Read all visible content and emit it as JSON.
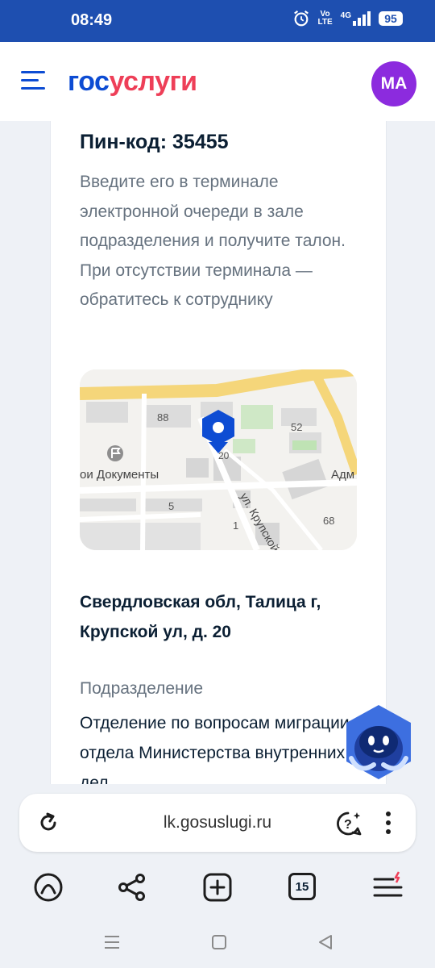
{
  "status_bar": {
    "time": "08:49",
    "volte_line1": "Vo",
    "volte_line2": "LTE",
    "network": "4G",
    "battery": "95",
    "icons": [
      "alarm-icon",
      "volte-icon",
      "signal-icon",
      "battery-icon"
    ]
  },
  "header": {
    "logo_part1": "гос",
    "logo_part2": "услуги",
    "avatar_initials": "МА",
    "colors": {
      "brand_blue": "#0d4cd3",
      "brand_red": "#ee3f58",
      "avatar": "#8c2bde"
    }
  },
  "card": {
    "pin_label": "Пин-код: 35455",
    "description": "Введите его в терминале электронной очереди в зале подразделения и получите талон. При отсутствии терминала — обратитесь к сотруднику",
    "map": {
      "label_88": "88",
      "label_52": "52",
      "label_20": "20",
      "label_5": "5",
      "label_1": "1",
      "label_68": "68",
      "poi": "ои Документы",
      "street": "ул. Крупской",
      "adm": "Адм"
    },
    "address": "Свердловская обл, Талица г, Крупской ул, д. 20",
    "department_label": "Подразделение",
    "department_value": "Отделение по вопросам миграции отдела Министерства внутренних дел"
  },
  "browser": {
    "url": "lk.gosuslugi.ru",
    "tab_count": "15"
  }
}
